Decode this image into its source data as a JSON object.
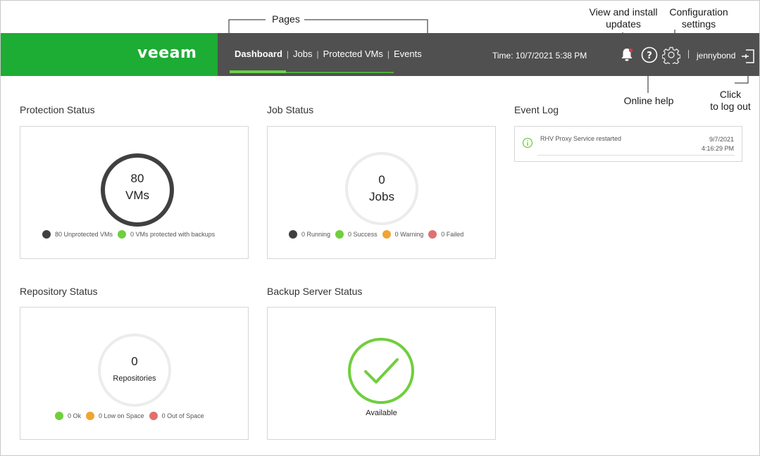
{
  "header": {
    "logo": "veeam",
    "nav": [
      "Dashboard",
      "Jobs",
      "Protected VMs",
      "Events"
    ],
    "active_nav": "Dashboard",
    "time": "Time: 10/7/2021 5:38 PM",
    "user": "jennybond",
    "icons": [
      "bell-icon",
      "help-icon",
      "gear-icon",
      "logout-icon"
    ],
    "colors": {
      "brand_green": "#1dac34",
      "header_bg": "#505050",
      "active_underline": "#6ad24a"
    }
  },
  "callouts": {
    "pages": "Pages",
    "updates_line1": "View and install",
    "updates_line2": "updates",
    "config_line1": "Configuration",
    "config_line2": "settings",
    "help": "Online  help",
    "logout_line1": "Click",
    "logout_line2": "to log  out"
  },
  "protection": {
    "title": "Protection Status",
    "count": "80",
    "unit": "VMs",
    "legend": [
      {
        "label": "80 Unprotected VMs",
        "color": "#404040"
      },
      {
        "label": "0 VMs protected with backups",
        "color": "#6fcf3c"
      }
    ]
  },
  "jobs": {
    "title": "Job Status",
    "count": "0",
    "unit": "Jobs",
    "legend": [
      {
        "label": "0 Running",
        "color": "#404040"
      },
      {
        "label": "0 Success",
        "color": "#6fcf3c"
      },
      {
        "label": "0 Warning",
        "color": "#f0a431"
      },
      {
        "label": "0 Failed",
        "color": "#e07070"
      }
    ]
  },
  "event_log": {
    "title": "Event Log",
    "events": [
      {
        "message": "RHV Proxy Service restarted",
        "date": "9/7/2021",
        "time": "4:16:29 PM"
      }
    ]
  },
  "repository": {
    "title": "Repository Status",
    "count": "0",
    "unit": "Repositories",
    "legend": [
      {
        "label": "0 Ok",
        "color": "#6fcf3c"
      },
      {
        "label": "0 Low on Space",
        "color": "#f0a431"
      },
      {
        "label": "0 Out of Space",
        "color": "#e07070"
      }
    ]
  },
  "backup_server": {
    "title": "Backup Server Status",
    "status": "Available",
    "color": "#6fcf3c"
  }
}
